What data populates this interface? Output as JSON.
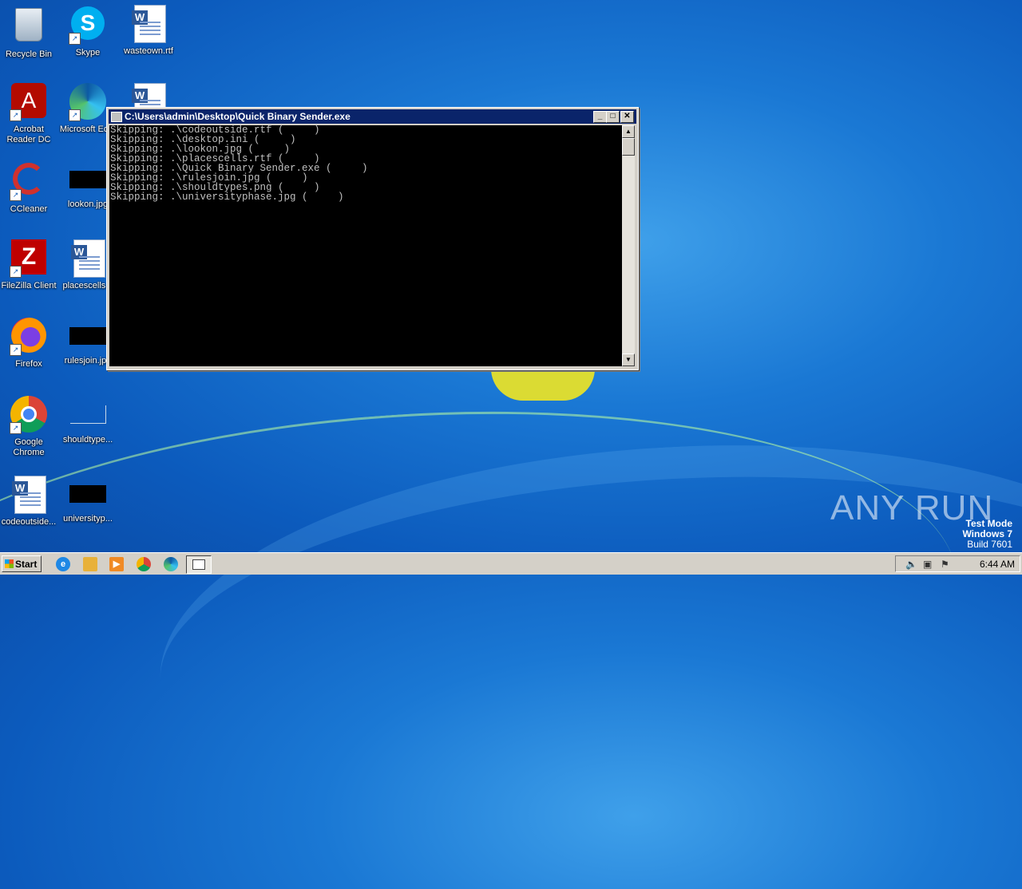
{
  "desktop": {
    "icons": [
      {
        "label": "Recycle Bin"
      },
      {
        "label": "Skype"
      },
      {
        "label": "wasteown.rtf"
      },
      {
        "label": "Acrobat Reader DC"
      },
      {
        "label": "Microsoft Ed..."
      },
      {
        "label": "CCleaner"
      },
      {
        "label": "lookon.jpg"
      },
      {
        "label": "FileZilla Client"
      },
      {
        "label": "placescells..."
      },
      {
        "label": "Firefox"
      },
      {
        "label": "rulesjoin.jpg"
      },
      {
        "label": "Google Chrome"
      },
      {
        "label": "shouldtype..."
      },
      {
        "label": "codeoutside..."
      },
      {
        "label": "universityp..."
      }
    ]
  },
  "console_window": {
    "title": "C:\\Users\\admin\\Desktop\\Quick Binary Sender.exe",
    "lines": [
      "Skipping: .\\codeoutside.rtf (     )",
      "Skipping: .\\desktop.ini (     )",
      "Skipping: .\\lookon.jpg (     )",
      "Skipping: .\\placescells.rtf (     )",
      "Skipping: .\\Quick Binary Sender.exe (     )",
      "Skipping: .\\rulesjoin.jpg (     )",
      "Skipping: .\\shouldtypes.png (     )",
      "Skipping: .\\universityphase.jpg (     )"
    ],
    "minimize": "_",
    "maximize": "□",
    "close": "✕"
  },
  "taskbar": {
    "start_label": "Start",
    "clock": "6:44 AM"
  },
  "watermark": {
    "line1": "Test Mode",
    "line2": "Windows 7",
    "line3": "Build 7601",
    "brand": "ANY RUN"
  }
}
